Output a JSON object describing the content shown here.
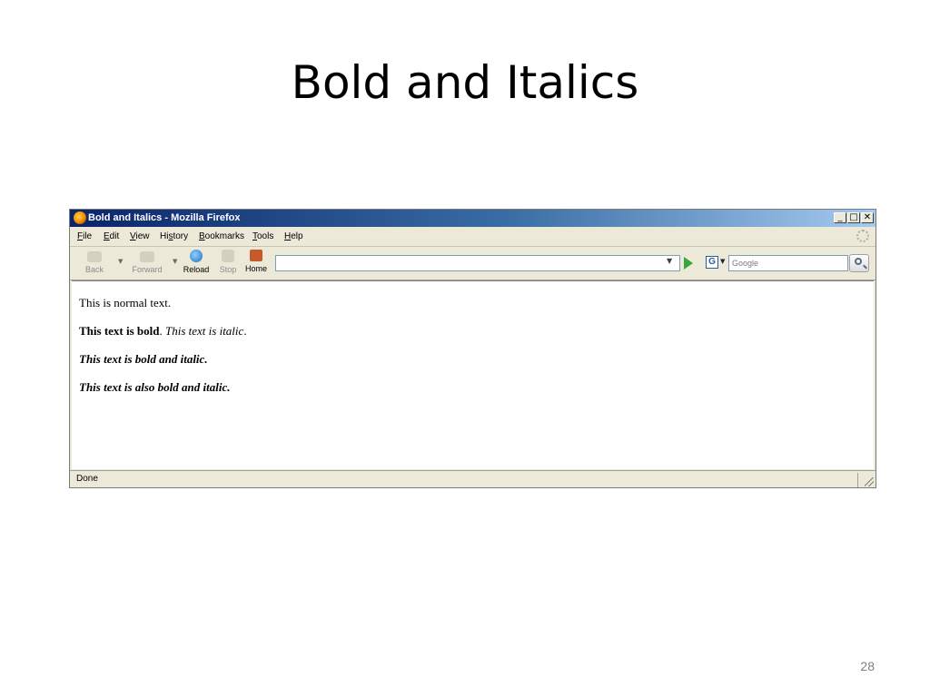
{
  "slide": {
    "title": "Bold and Italics",
    "page_number": "28"
  },
  "window": {
    "title": "Bold and Italics - Mozilla Firefox",
    "caption_buttons": {
      "minimize": "_",
      "maximize": "□",
      "close": "✕"
    }
  },
  "menu": {
    "items": [
      {
        "u": "F",
        "rest": "ile"
      },
      {
        "u": "E",
        "rest": "dit"
      },
      {
        "u": "V",
        "rest": "iew"
      },
      {
        "pre": "Hi",
        "u": "s",
        "rest": "tory"
      },
      {
        "u": "B",
        "rest": "ookmarks"
      },
      {
        "u": "T",
        "rest": "ools"
      },
      {
        "u": "H",
        "rest": "elp"
      }
    ]
  },
  "toolbar": {
    "back": "Back",
    "forward": "Forward",
    "reload": "Reload",
    "stop": "Stop",
    "home": "Home",
    "url_value": "",
    "search_engine_letter": "G",
    "search_placeholder": "Google"
  },
  "page": {
    "normal": "This is normal text.",
    "bold": "This text is bold",
    "bold_end": ". ",
    "italic": "This text is italic",
    "italic_end": ".",
    "bold_italic": "This text is bold and italic.",
    "also_bold_italic": "This text is also bold and italic."
  },
  "status": {
    "text": "Done"
  },
  "colors": {
    "titlebar_start": "#0a246a",
    "titlebar_end": "#a6caf0",
    "chrome": "#ece9d8"
  },
  "icons": {
    "title": "firefox-icon",
    "back": "back-arrow-icon",
    "forward": "forward-arrow-icon",
    "reload": "reload-icon",
    "stop": "stop-icon",
    "home": "home-icon",
    "go": "go-arrow-icon",
    "search": "magnifier-icon",
    "engine": "google-icon",
    "throbber": "throbber-icon"
  }
}
